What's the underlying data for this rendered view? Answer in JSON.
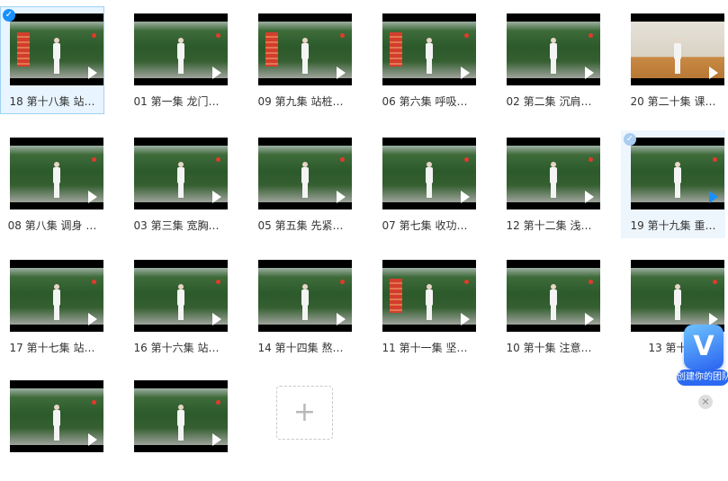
{
  "files": [
    {
      "label": "18 第十八集 站…",
      "selected": true,
      "scene": "outdoor",
      "banner": true
    },
    {
      "label": "01 第一集 龙门…",
      "scene": "outdoor",
      "banner": false
    },
    {
      "label": "09 第九集 站桩…",
      "scene": "outdoor",
      "banner": true
    },
    {
      "label": "06 第六集 呼吸…",
      "scene": "outdoor",
      "banner": true
    },
    {
      "label": "02 第二集 沉肩…",
      "scene": "outdoor",
      "banner": false
    },
    {
      "label": "20 第二十集 课…",
      "scene": "indoor",
      "banner": false
    },
    {
      "label": "08 第八集 调身 …",
      "scene": "outdoor",
      "banner": false
    },
    {
      "label": "03 第三集 宽胸…",
      "scene": "outdoor",
      "banner": false
    },
    {
      "label": "05 第五集 先紧…",
      "scene": "outdoor",
      "banner": false
    },
    {
      "label": "07 第七集 收功…",
      "scene": "outdoor",
      "banner": false
    },
    {
      "label": "12 第十二集 浅…",
      "scene": "outdoor",
      "banner": false
    },
    {
      "label": "19 第十九集 重…",
      "hovered": true,
      "scene": "outdoor",
      "banner": false
    },
    {
      "label": "17 第十七集 站…",
      "scene": "outdoor",
      "banner": false
    },
    {
      "label": "16 第十六集 站…",
      "scene": "outdoor",
      "banner": false
    },
    {
      "label": "14 第十四集 熬…",
      "scene": "outdoor",
      "banner": false
    },
    {
      "label": "11 第十一集 坚…",
      "scene": "outdoor",
      "banner": true
    },
    {
      "label": "10 第十集 注意…",
      "scene": "outdoor",
      "banner": false
    },
    {
      "label": "13 第十三",
      "scene": "outdoor",
      "banner": false
    },
    {
      "label": "",
      "scene": "outdoor",
      "banner": false
    },
    {
      "label": "",
      "scene": "outdoor",
      "banner": false
    }
  ],
  "add_button": {
    "icon": "plus-icon",
    "glyph": "+"
  },
  "promo": {
    "logo_letter": "V",
    "caption": "创建你的团队"
  },
  "close_glyph": "×",
  "colors": {
    "accent": "#1890ff",
    "selected_bg": "#e8f4ff"
  }
}
